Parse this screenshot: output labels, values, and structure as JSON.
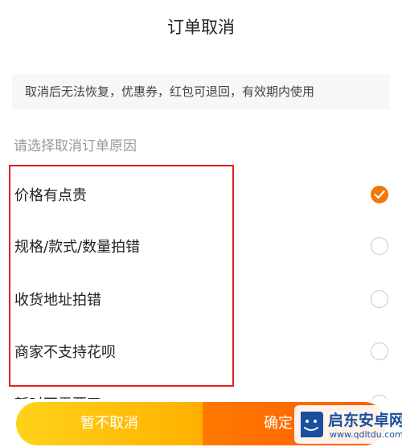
{
  "header": {
    "title": "订单取消"
  },
  "notice": {
    "text": "取消后无法恢复，优惠券，红包可退回，有效期内使用"
  },
  "reasons": {
    "section_label": "请选择取消订单原因",
    "items": [
      {
        "label": "价格有点贵",
        "selected": true
      },
      {
        "label": "规格/款式/数量拍错",
        "selected": false
      },
      {
        "label": "收货地址拍错",
        "selected": false
      },
      {
        "label": "商家不支持花呗",
        "selected": false
      },
      {
        "label": "暂时不需要了",
        "selected": false
      }
    ]
  },
  "actions": {
    "keep_label": "暂不取消",
    "confirm_label": "确定"
  },
  "watermark": {
    "text": "启东安卓网",
    "url": "www.qdltdu.com"
  },
  "colors": {
    "accent": "#f0780a",
    "highlight_box": "#e02020",
    "keep_gradient_start": "#ffd21a",
    "confirm_gradient_start": "#ff7a00"
  }
}
